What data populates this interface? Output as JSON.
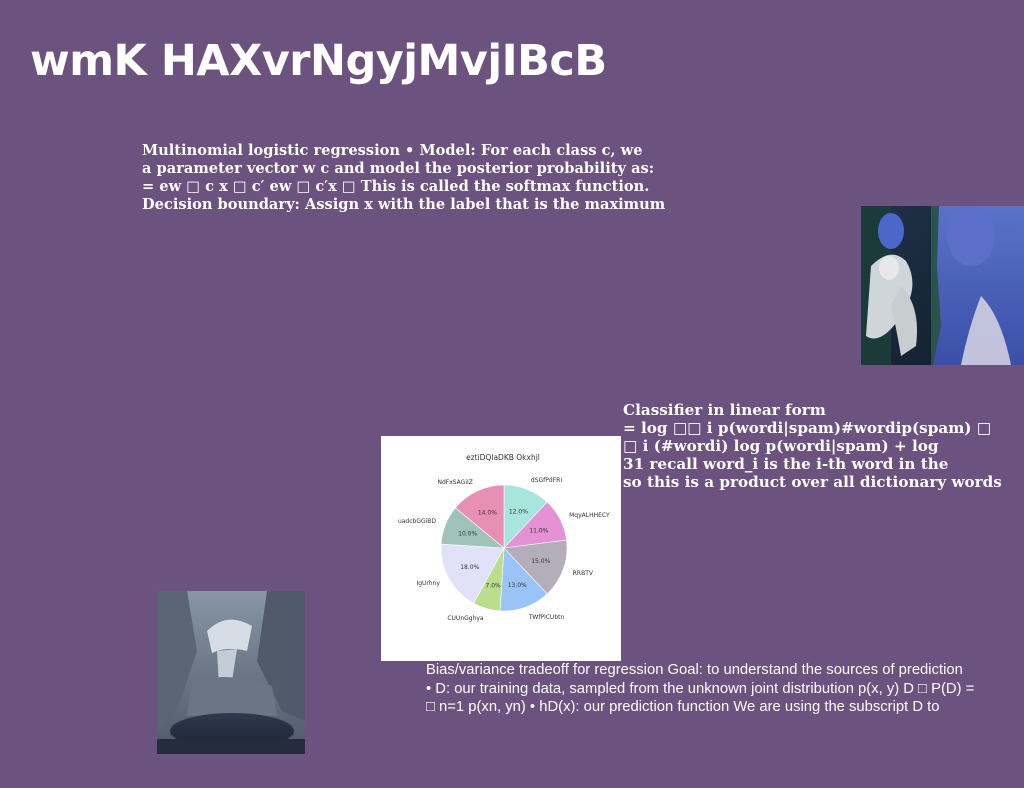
{
  "title": "wmK HAXvrNgyjMvjIBcB",
  "block1": {
    "lines": [
      "Multinomial logistic regression • Model: For each class c, we",
      "a parameter vector w c and model the posterior probability as:",
      "= ew □ c x □ c′ ew □ c′x □ This is called the softmax function.",
      "Decision boundary: Assign x with the label that is the maximum"
    ]
  },
  "block2": {
    "lines": [
      "Classifier in linear form",
      "= log □□ i p(wordi|spam)#wordip(spam) □",
      "□ i (#wordi) log p(wordi|spam) + log",
      "31 recall word_i is the i-th word in the",
      "so this is a product over all dictionary words"
    ]
  },
  "block3": {
    "lines": [
      "Bias/variance tradeoff for regression Goal: to understand the sources of prediction",
      "• D: our training data, sampled from the unknown joint distribution p(x, y) D □ P(D) =",
      "□ n=1 p(xn, yn) • hD(x): our prediction function We are using the subscript D to"
    ]
  },
  "chart_data": {
    "type": "pie",
    "title": "eztiDQlaDKB Okxhjl",
    "categories": [
      "dSGfPdFRI",
      "MqyALHHECY",
      "RRBTV",
      "TWfPlCUbtn",
      "CUUnGghya",
      "IgUrhny",
      "uadcbGGiBD",
      "NdFxSAGiIZ"
    ],
    "values": [
      12.0,
      11.0,
      15.0,
      13.0,
      7.0,
      18.0,
      10.0,
      14.0
    ],
    "labels": [
      "12.0%",
      "11.0%",
      "15.0%",
      "13.0%",
      "7.0%",
      "18.0%",
      "10.0%",
      "14.0%"
    ],
    "colors": [
      "#a7e6dc",
      "#e591d6",
      "#b3aeb9",
      "#99c4f5",
      "#b9df8e",
      "#e1e1fa",
      "#9fc3b8",
      "#e88fb6"
    ],
    "start_angle_deg": 90,
    "direction": "clockwise"
  }
}
